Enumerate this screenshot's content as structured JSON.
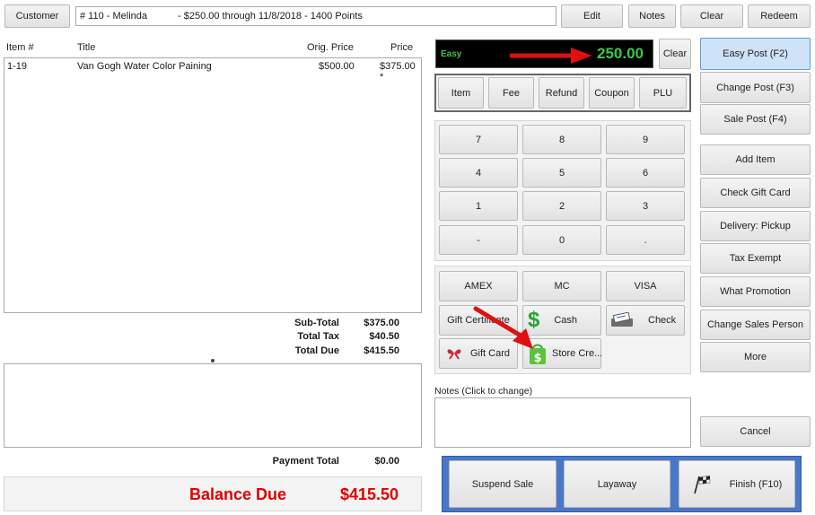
{
  "top_bar": {
    "customer_button": "Customer",
    "customer_info_prefix": "# 110 - Melinda",
    "customer_info_suffix": "-  $250.00 through 11/8/2018 - 1400 Points",
    "edit_button": "Edit",
    "notes_button": "Notes",
    "clear_button": "Clear",
    "redeem_button": "Redeem"
  },
  "items_table": {
    "columns": {
      "item": "Item #",
      "title": "Title",
      "orig_price": "Orig. Price",
      "price": "Price"
    },
    "rows": [
      {
        "item": "1-19",
        "title": "Van Gogh Water Color Paining",
        "orig_price": "$500.00",
        "price": "$375.00 *"
      }
    ]
  },
  "summary": {
    "subtotal_label": "Sub-Total",
    "subtotal_value": "$375.00",
    "tax_label": "Total Tax",
    "tax_value": "$40.50",
    "due_label": "Total Due",
    "due_value": "$415.50",
    "payment_label": "Payment Total",
    "payment_value": "$0.00",
    "balance_label": "Balance Due",
    "balance_value": "$415.50"
  },
  "display": {
    "mode": "Easy",
    "amount": "250.00",
    "clear_button": "Clear"
  },
  "item_types": [
    "Item",
    "Fee",
    "Refund",
    "Coupon",
    "PLU"
  ],
  "keypad": [
    "7",
    "8",
    "9",
    "4",
    "5",
    "6",
    "1",
    "2",
    "3",
    "-",
    "0",
    "."
  ],
  "tenders": {
    "amex": "AMEX",
    "mc": "MC",
    "visa": "VISA",
    "gift_certificate": "Gift Certificate",
    "cash": "Cash",
    "check": "Check",
    "gift_card": "Gift Card",
    "store_credit": "Store Cre..."
  },
  "notes": {
    "label": "Notes (Click to change)"
  },
  "side_buttons": {
    "easy_post": "Easy Post (F2)",
    "change_post": "Change Post (F3)",
    "sale_post": "Sale Post (F4)",
    "add_item": "Add Item",
    "check_gift_card": "Check Gift Card",
    "delivery_pickup": "Delivery: Pickup",
    "tax_exempt": "Tax Exempt",
    "what_promotion": "What Promotion",
    "change_sales_person": "Change Sales Person",
    "more": "More",
    "cancel": "Cancel"
  },
  "bottom_actions": {
    "suspend_sale": "Suspend Sale",
    "layaway": "Layaway",
    "finish": "Finish (F10)"
  },
  "colors": {
    "display_bg": "#000000",
    "display_text": "#3cc84a",
    "balance_red": "#e00000",
    "annotation_arrow": "#e01010",
    "action_panel_blue": "#4a78c8",
    "selected_button": "#cfe3f8"
  }
}
